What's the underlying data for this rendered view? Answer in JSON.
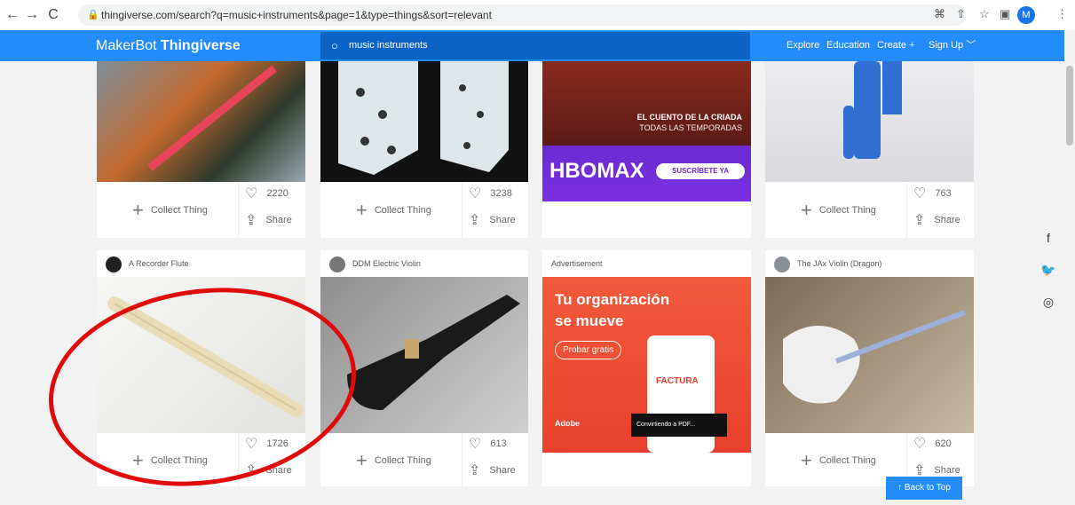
{
  "browser": {
    "url": "thingiverse.com/search?q=music+instruments&page=1&type=things&sort=relevant",
    "avatar_letter": "M"
  },
  "header": {
    "logo_prefix": "MakerBot",
    "logo_name": "Thingiverse",
    "search_value": "music instruments",
    "nav": [
      "Explore",
      "Education",
      "Create +",
      "Sign Up ﹀"
    ]
  },
  "row1": [
    {
      "likes": "2220",
      "collect": "Collect Thing",
      "share": "Share"
    },
    {
      "likes": "3238",
      "collect": "Collect Thing",
      "share": "Share"
    },
    {
      "ad_text1": "EL CUENTO DE LA CRIADA",
      "ad_text2": "TODAS LAS TEMPORADAS",
      "ad_brand": "HBOMAX",
      "ad_cta": "SUSCRÍBETE YA"
    },
    {
      "likes": "763",
      "collect": "Collect Thing",
      "share": "Share"
    }
  ],
  "row2": [
    {
      "title": "A Recorder Flute",
      "likes": "1726",
      "collect": "Collect Thing",
      "share": "Share"
    },
    {
      "title": "DDM Electric Violin",
      "likes": "613",
      "collect": "Collect Thing",
      "share": "Share"
    },
    {
      "title": "Advertisement",
      "ad_head1": "Tu organización",
      "ad_head2": "se mueve",
      "ad_cta": "Probar gratis",
      "ad_doc": "FACTURA",
      "ad_brand": "Adobe",
      "ad_toast": "Convirtiendo a PDF..."
    },
    {
      "title": "The JAx Violin (Dragon)",
      "likes": "620",
      "collect": "Collect Thing",
      "share": "Share"
    }
  ],
  "back_to_top": "Back to Top",
  "colors": {
    "brand": "#248bfb",
    "annotation": "#e10a0a"
  }
}
